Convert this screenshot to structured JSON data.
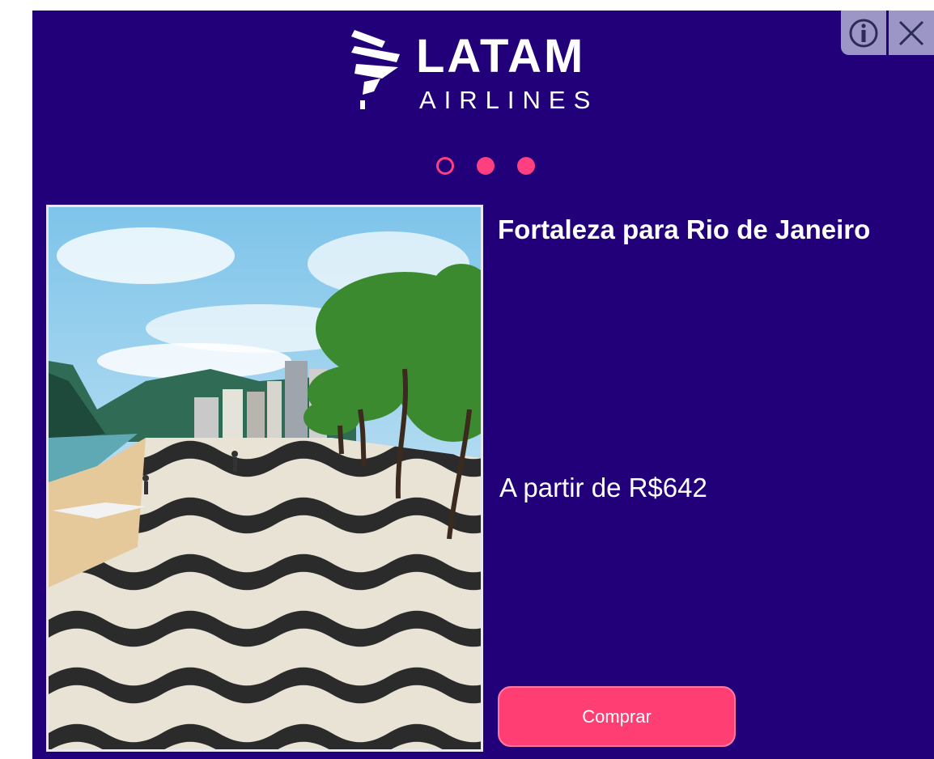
{
  "brand": {
    "name_top": "LATAM",
    "name_bottom": "AIRLINES"
  },
  "ad_controls": {
    "info_icon": "info-icon",
    "close_icon": "close-icon"
  },
  "carousel": {
    "current_index": 1,
    "total": 3
  },
  "offer": {
    "route": "Fortaleza para Rio de Janeiro",
    "price_text": "A partir de R$642",
    "cta_label": "Comprar",
    "image_subject": "Copacabana beach promenade, Rio de Janeiro"
  },
  "colors": {
    "background": "#22007a",
    "accent": "#ff3f74",
    "text": "#ffffff",
    "control": "#9b96c6"
  }
}
